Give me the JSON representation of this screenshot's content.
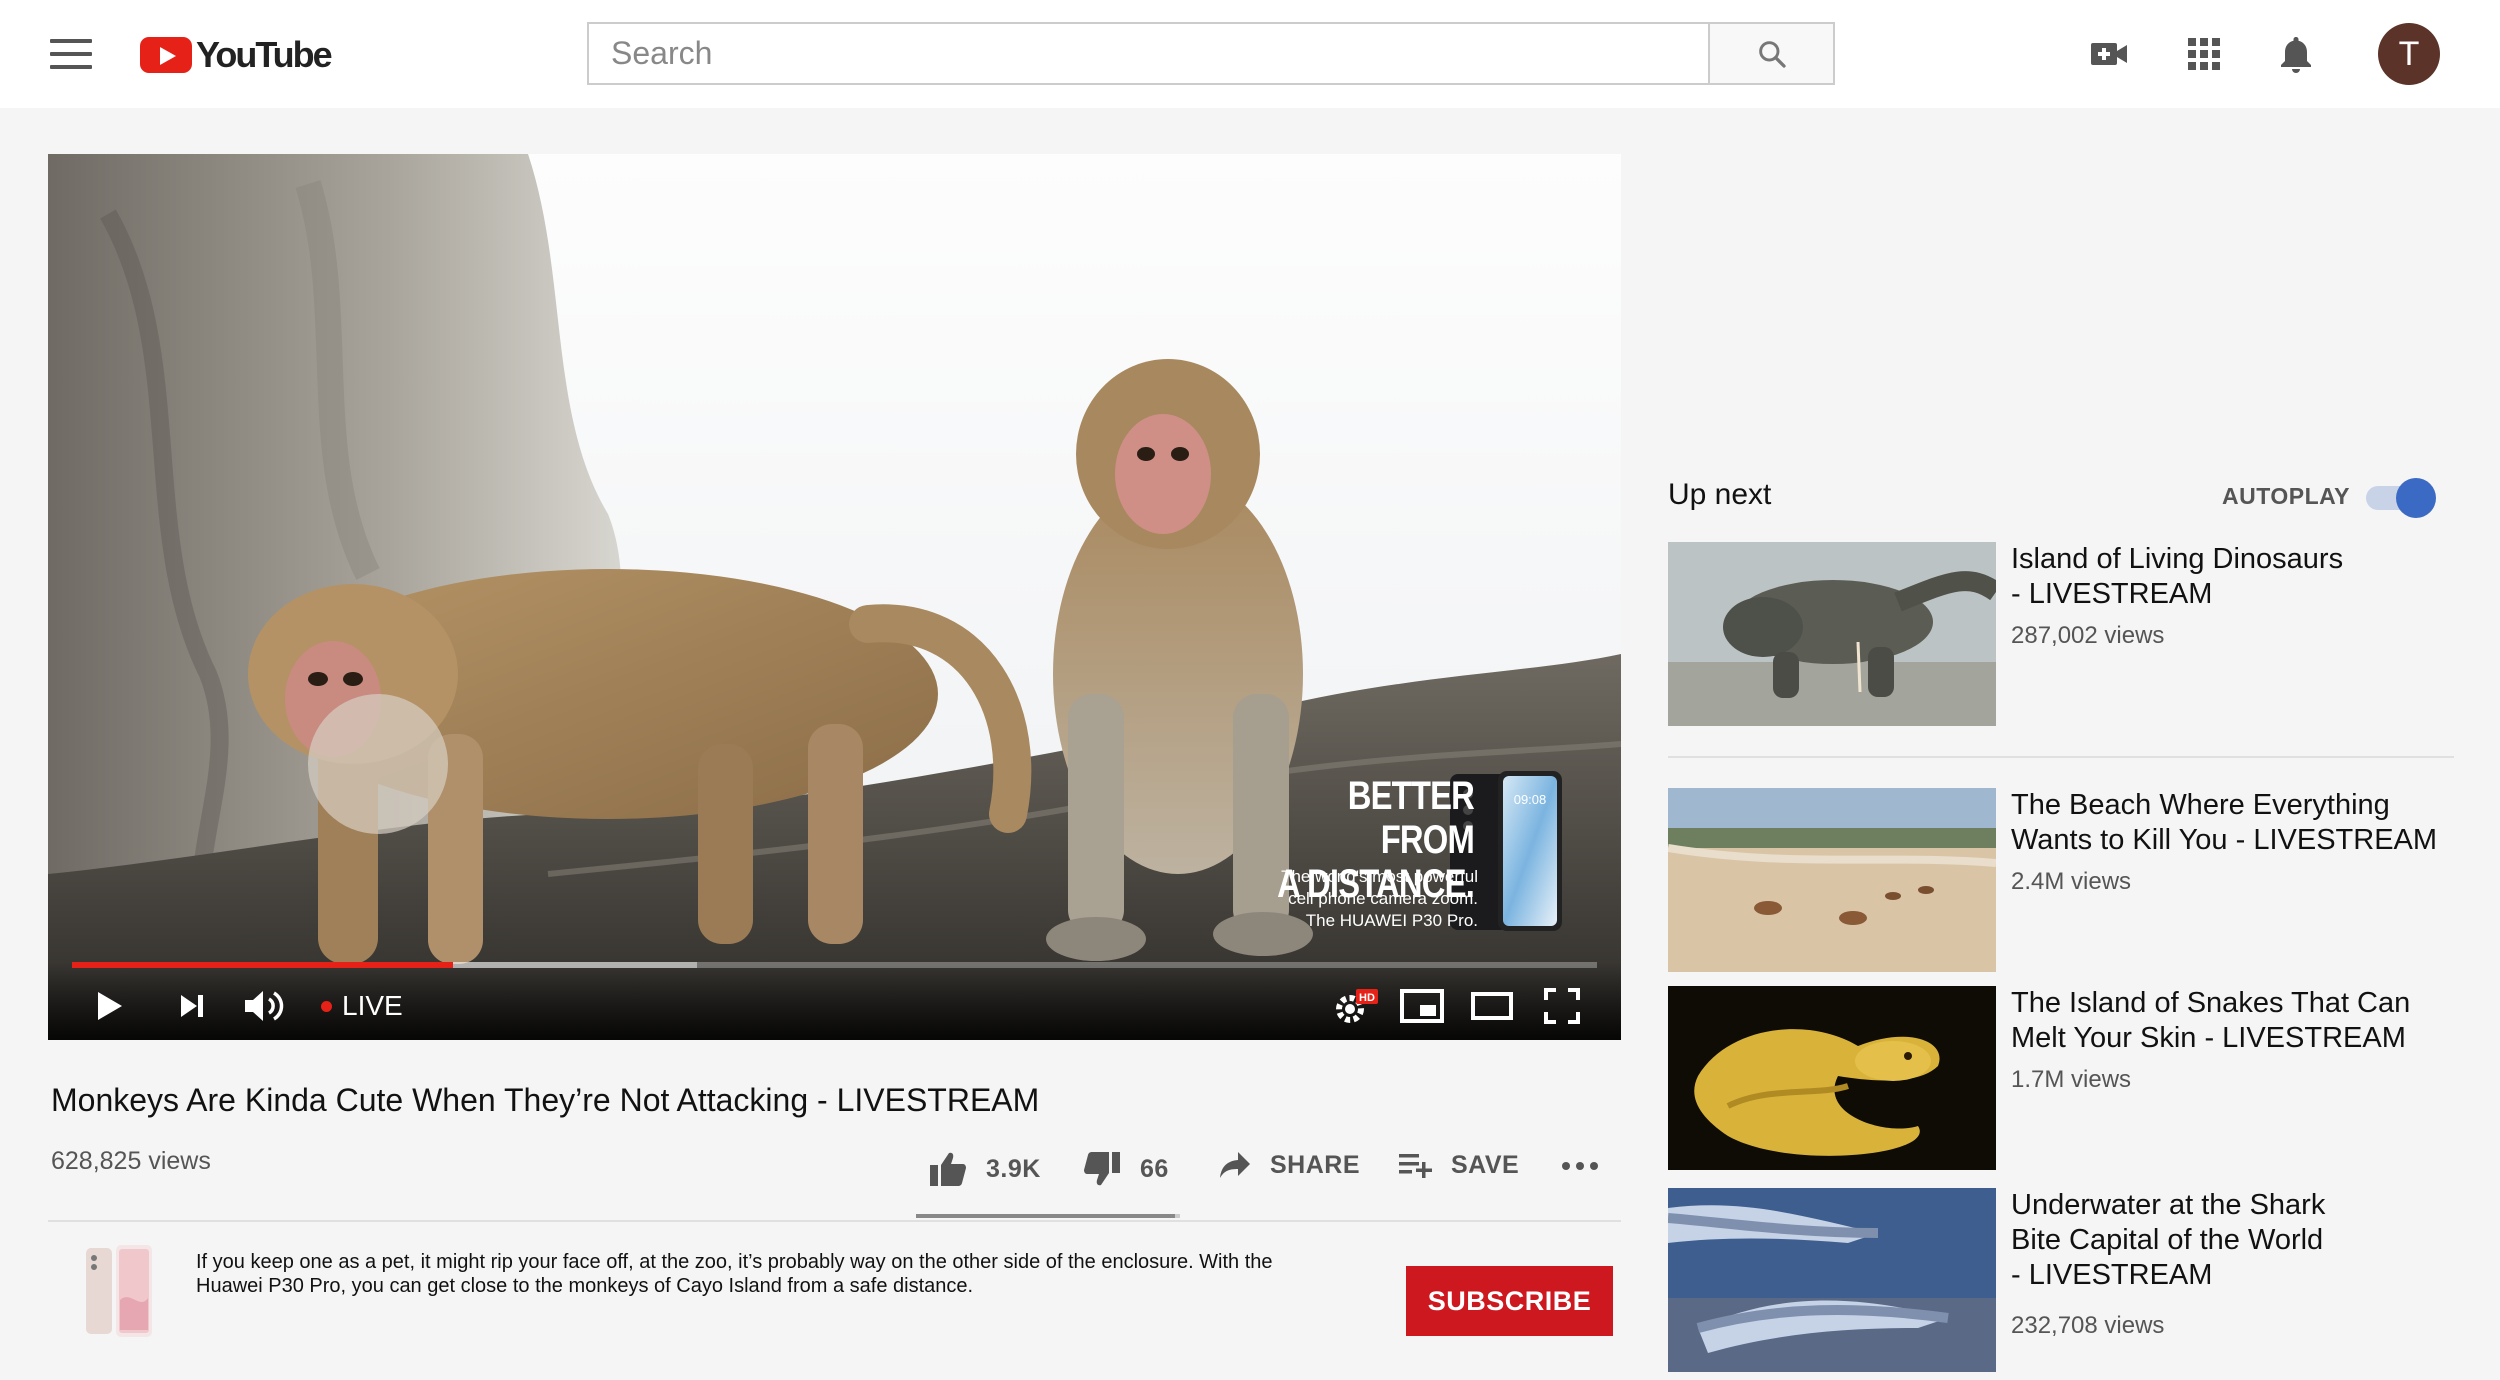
{
  "header": {
    "logo_text": "YouTube",
    "search_placeholder": "Search",
    "avatar_letter": "T"
  },
  "player": {
    "live_label": "LIVE",
    "progress_played_fraction": 0.25,
    "progress_loaded_fraction": 0.41,
    "ad": {
      "headline_line1": "BETTER FROM",
      "headline_line2": "A DISTANCE.",
      "copy_line1": "The world's most powerful",
      "copy_line2": "cell phone camera zoom.",
      "copy_line3": "The HUAWEI P30 Pro.",
      "phone_time": "09:08"
    },
    "quality_badge": "HD"
  },
  "video": {
    "title": "Monkeys Are Kinda Cute When They’re Not Attacking - LIVESTREAM",
    "views": "628,825 views",
    "likes": "3.9K",
    "dislikes": "66",
    "share_label": "SHARE",
    "save_label": "SAVE",
    "like_fraction": 0.98
  },
  "description": {
    "line1": "If you keep one as a pet, it might rip your face off, at the zoo, it’s probably way on the other side of the enclosure. With the",
    "line2": "Huawei P30 Pro, you can get close to the monkeys of Cayo Island from a safe distance.",
    "subscribe_label": "SUBSCRIBE"
  },
  "sidebar": {
    "up_next_label": "Up next",
    "autoplay_label": "AUTOPLAY",
    "autoplay_on": true,
    "items": [
      {
        "title_line1": "Island of Living Dinosaurs",
        "title_line2": "- LIVESTREAM",
        "title_line3": "",
        "views": "287,002 views"
      },
      {
        "title_line1": "The Beach Where Everything",
        "title_line2": "Wants to Kill You - LIVESTREAM",
        "title_line3": "",
        "views": "2.4M views"
      },
      {
        "title_line1": "The Island of Snakes That Can",
        "title_line2": "Melt Your Skin - LIVESTREAM",
        "title_line3": "",
        "views": "1.7M views"
      },
      {
        "title_line1": "Underwater at the Shark",
        "title_line2": "Bite Capital of the World",
        "title_line3": "- LIVESTREAM",
        "views": "232,708 views"
      }
    ]
  },
  "colors": {
    "brand_red": "#e62117",
    "subscribe_red": "#cc181e",
    "toggle_blue": "#3a6ac4"
  }
}
